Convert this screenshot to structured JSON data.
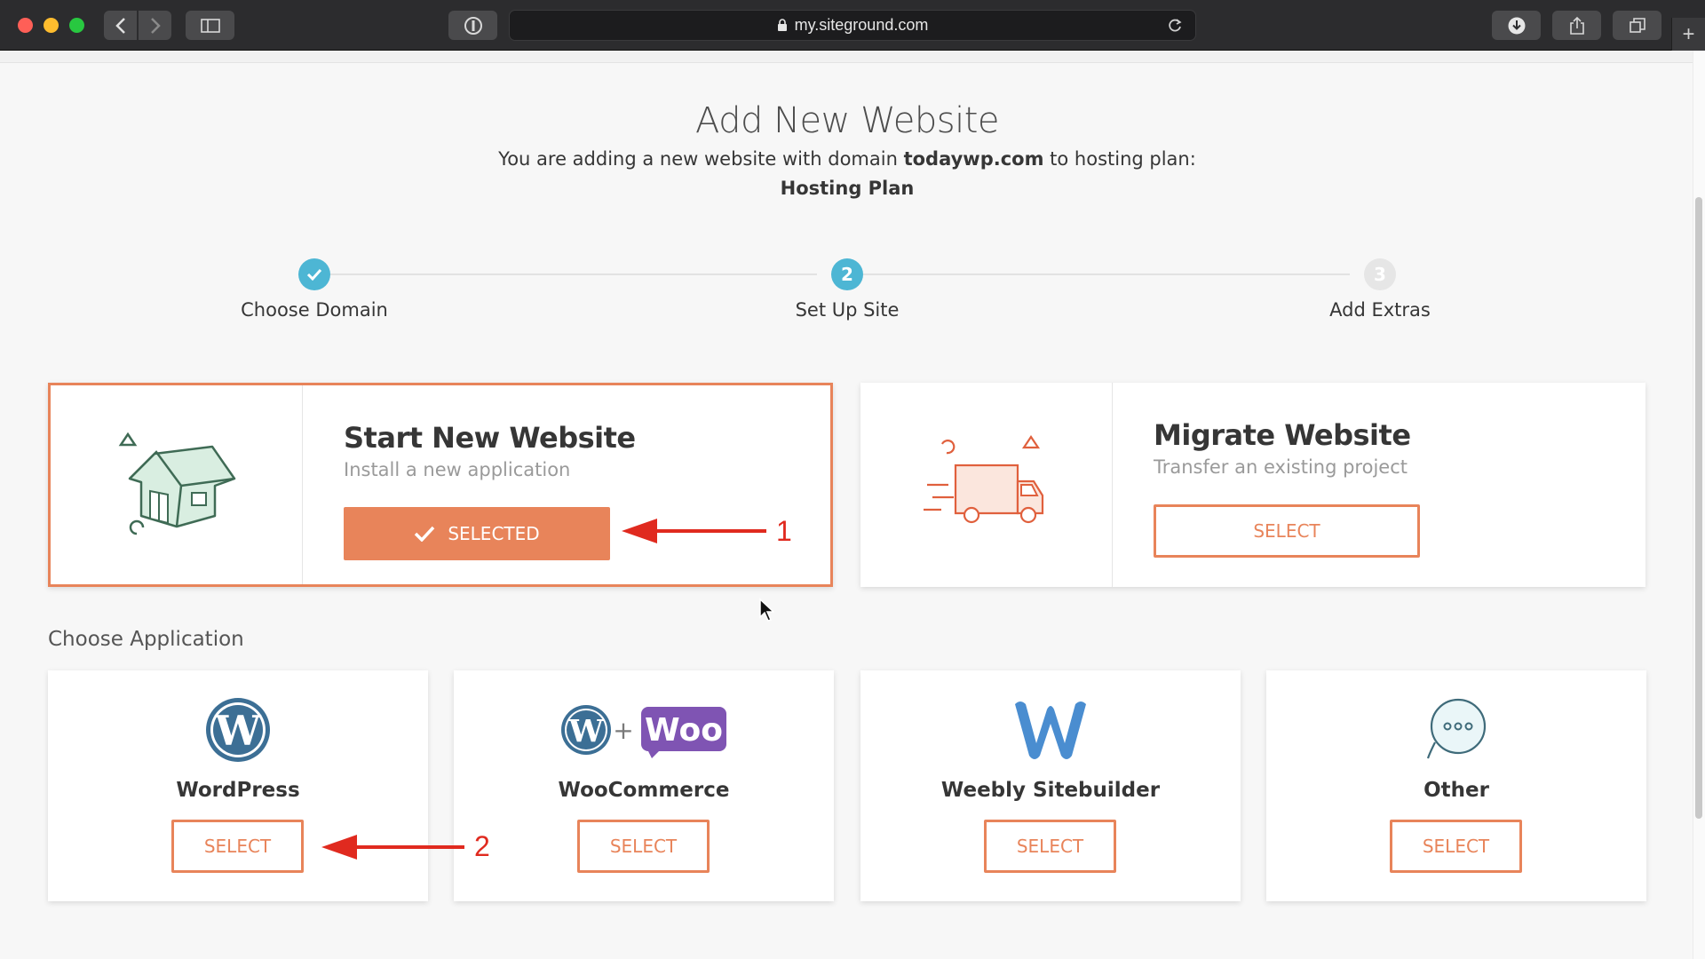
{
  "browser": {
    "url": "my.siteground.com"
  },
  "header": {
    "title": "Add New Website",
    "subtitle_prefix": "You are adding a new website with domain",
    "domain": "todaywp.com",
    "subtitle_suffix": "to hosting plan:",
    "plan": "Hosting Plan"
  },
  "stepper": {
    "steps": [
      {
        "label": "Choose Domain",
        "number": "",
        "state": "done"
      },
      {
        "label": "Set Up Site",
        "number": "2",
        "state": "active"
      },
      {
        "label": "Add Extras",
        "number": "3",
        "state": "pending"
      }
    ],
    "colors": {
      "done": "#4db6d4",
      "active": "#4db6d4",
      "pending": "#e2e2e2"
    }
  },
  "options": [
    {
      "title": "Start New Website",
      "subtitle": "Install a new application",
      "button": "SELECTED",
      "selected": true,
      "icon": "house-icon"
    },
    {
      "title": "Migrate Website",
      "subtitle": "Transfer an existing project",
      "button": "SELECT",
      "selected": false,
      "icon": "truck-icon"
    }
  ],
  "applications": {
    "section_label": "Choose Application",
    "items": [
      {
        "name": "WordPress",
        "button": "SELECT",
        "icon": "wordpress-icon"
      },
      {
        "name": "WooCommerce",
        "button": "SELECT",
        "icon": "woocommerce-icon",
        "logo_text": "Woo",
        "plus": "+"
      },
      {
        "name": "Weebly Sitebuilder",
        "button": "SELECT",
        "icon": "weebly-icon"
      },
      {
        "name": "Other",
        "button": "SELECT",
        "icon": "other-icon"
      }
    ]
  },
  "annotations": [
    {
      "label": "1"
    },
    {
      "label": "2"
    }
  ],
  "colors": {
    "accent": "#e8845a",
    "step": "#4db6d4",
    "annotation": "#e02a1f",
    "wordpress": "#3c6f95",
    "woo": "#7f54b3",
    "weebly": "#4a8dd0"
  }
}
